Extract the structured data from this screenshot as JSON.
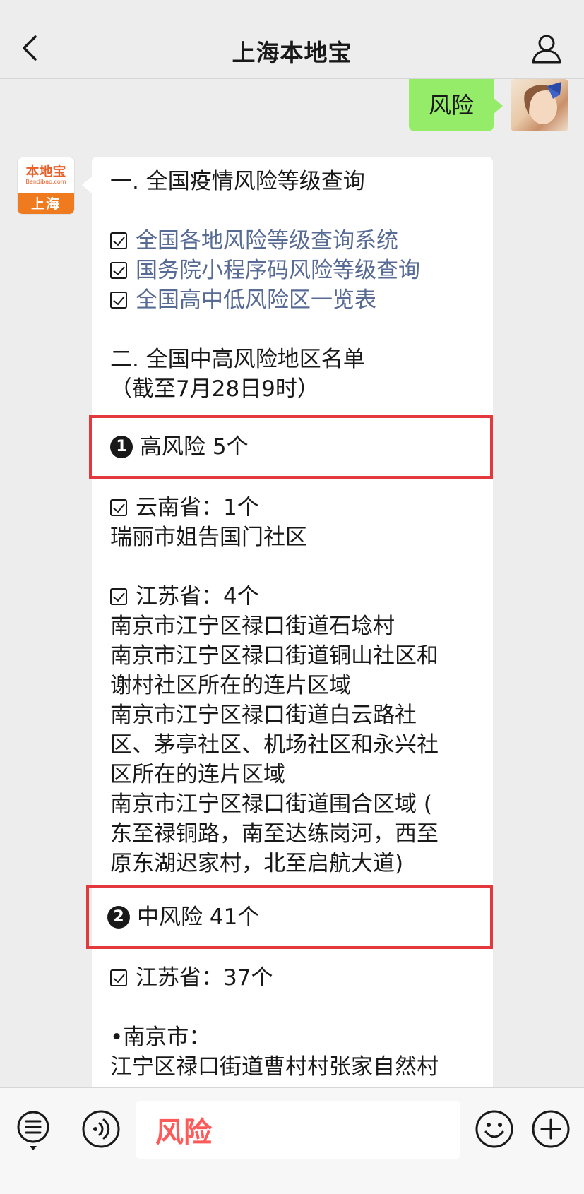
{
  "header": {
    "title": "上海本地宝"
  },
  "user_message": {
    "text": "风险"
  },
  "bot_avatar": {
    "brand": "本地宝",
    "domain": "Bendibao.com",
    "city": "上海"
  },
  "bot_message": {
    "section1_title": "一. 全国疫情风险等级查询",
    "links": [
      "全国各地风险等级查询系统",
      "国务院小程序码风险等级查询",
      "全国高中低风险区一览表"
    ],
    "section2_title": "二. 全国中高风险地区名单",
    "section2_date": "（截至7月28日9时）",
    "high_risk": {
      "number": "1",
      "label": "高风险 5个"
    },
    "yunnan": {
      "header": "云南省：1个",
      "areas": [
        "瑞丽市姐告国门社区"
      ]
    },
    "jiangsu_high": {
      "header": "江苏省：4个",
      "lines": [
        "南京市江宁区禄口街道石埝村",
        "南京市江宁区禄口街道铜山社区和",
        "谢村社区所在的连片区域",
        "南京市江宁区禄口街道白云路社",
        "区、茅亭社区、机场社区和永兴社",
        "区所在的连片区域",
        "南京市江宁区禄口街道围合区域 (",
        "东至禄铜路，南至达练岗河，西至",
        "原东湖迟家村，北至启航大道)"
      ]
    },
    "mid_risk": {
      "number": "2",
      "label": "中风险 41个"
    },
    "jiangsu_mid": {
      "header": "江苏省：37个",
      "city": "•南京市：",
      "lines": [
        "江宁区禄口街道曹村村张家自然村"
      ]
    }
  },
  "input": {
    "value": "风险"
  },
  "icons": {
    "back": "back-arrow-icon",
    "profile": "person-icon",
    "menu": "menu-list-icon",
    "voice": "voice-icon",
    "emoji": "emoji-icon",
    "plus": "plus-icon"
  },
  "colors": {
    "background": "#ededed",
    "user_bubble": "#95ec69",
    "link": "#576b95",
    "highlight_border": "#e4393c",
    "input_text": "#ff5a5a"
  }
}
